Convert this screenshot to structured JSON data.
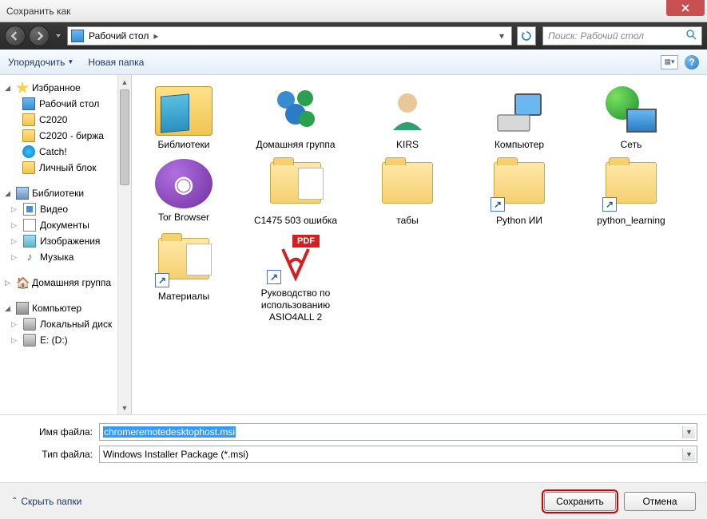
{
  "title": "Сохранить как",
  "address": {
    "location": "Рабочий стол",
    "arrow": "▸"
  },
  "search": {
    "placeholder": "Поиск: Рабочий стол"
  },
  "toolbar": {
    "organize": "Упорядочить",
    "newfolder": "Новая папка"
  },
  "sidebar": {
    "favorites": {
      "label": "Избранное",
      "items": [
        "Рабочий стол",
        "C2020",
        "C2020 - биржа",
        "Catch!",
        "Личный блок"
      ]
    },
    "libraries": {
      "label": "Библиотеки",
      "items": [
        "Видео",
        "Документы",
        "Изображения",
        "Музыка"
      ]
    },
    "homegroup": {
      "label": "Домашняя группа"
    },
    "computer": {
      "label": "Компьютер",
      "items": [
        "Локальный диск",
        "E: (D:)"
      ]
    }
  },
  "items": [
    {
      "label": "Библиотеки",
      "icon": "lib"
    },
    {
      "label": "Домашняя группа",
      "icon": "home"
    },
    {
      "label": "KIRS",
      "icon": "user"
    },
    {
      "label": "Компьютер",
      "icon": "comp"
    },
    {
      "label": "Сеть",
      "icon": "net"
    },
    {
      "label": "Tor Browser",
      "icon": "tor"
    },
    {
      "label": "C1475 503 ошибка",
      "icon": "folderdoc"
    },
    {
      "label": "табы",
      "icon": "folder"
    },
    {
      "label": "Python ИИ",
      "icon": "folder",
      "shortcut": true
    },
    {
      "label": "python_learning",
      "icon": "folder",
      "shortcut": true
    },
    {
      "label": "Материалы",
      "icon": "folderdoc",
      "shortcut": true
    },
    {
      "label": "Руководство по использованию ASIO4ALL 2",
      "icon": "pdf",
      "shortcut": true
    }
  ],
  "form": {
    "filename_label": "Имя файла:",
    "filename_value": "chromeremotedesktophost.msi",
    "filetype_label": "Тип файла:",
    "filetype_value": "Windows Installer Package (*.msi)"
  },
  "footer": {
    "hide": "Скрыть папки",
    "save": "Сохранить",
    "cancel": "Отмена"
  }
}
